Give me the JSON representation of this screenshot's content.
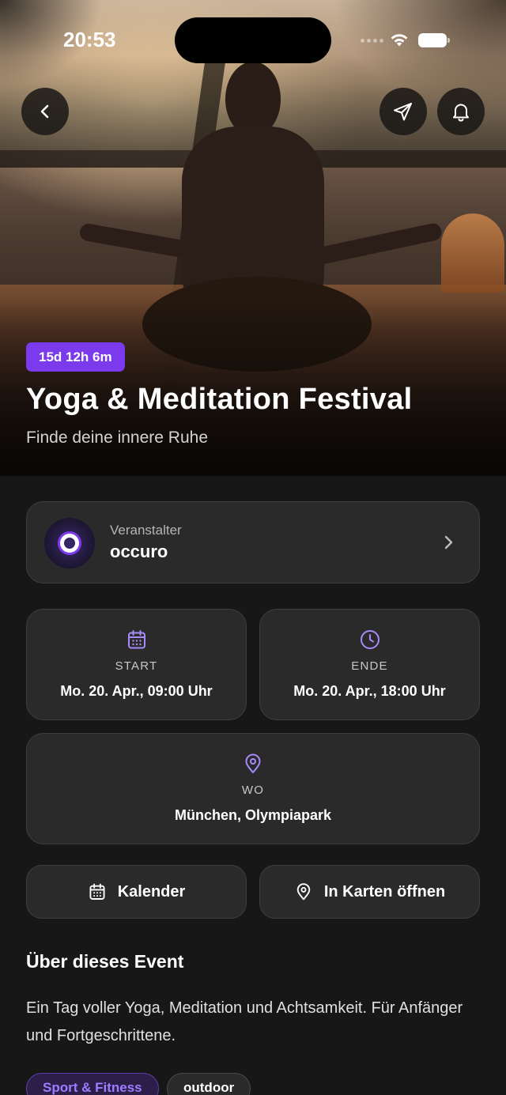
{
  "status_bar": {
    "time": "20:53"
  },
  "hero": {
    "countdown": "15d 12h 6m",
    "title": "Yoga & Meditation Festival",
    "subtitle": "Finde deine innere Ruhe"
  },
  "organizer": {
    "label": "Veranstalter",
    "name": "occuro"
  },
  "start": {
    "label": "START",
    "value": "Mo. 20. Apr., 09:00 Uhr"
  },
  "ende": {
    "label": "ENDE",
    "value": "Mo. 20. Apr., 18:00 Uhr"
  },
  "wo": {
    "label": "WO",
    "value": "München, Olympiapark"
  },
  "actions": {
    "calendar": "Kalender",
    "maps": "In Karten öffnen"
  },
  "about": {
    "heading": "Über dieses Event",
    "text": "Ein Tag voller Yoga, Meditation und Achtsamkeit. Für Anfänger und Fortgeschrittene."
  },
  "tags": [
    "Sport & Fitness",
    "outdoor"
  ],
  "colors": {
    "accent": "#7c3aed",
    "accent_light": "#a78bfa",
    "background": "#171717",
    "card": "#2a2a2a"
  }
}
